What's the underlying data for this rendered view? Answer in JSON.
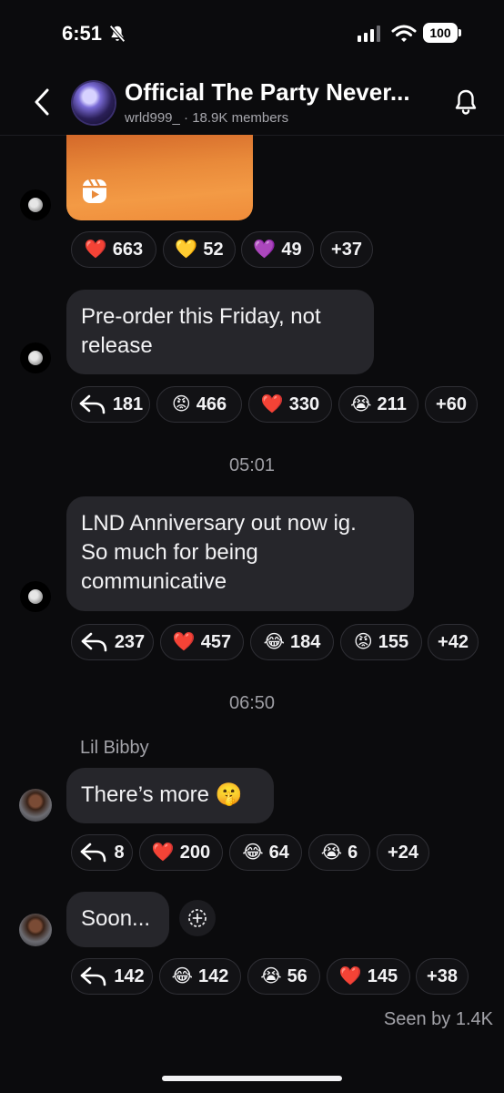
{
  "status_bar": {
    "time": "6:51",
    "battery": "100"
  },
  "header": {
    "title": "Official The Party Never...",
    "subtitle": "wrld999_ · 18.9K members"
  },
  "messages": [
    {
      "type": "reel",
      "reactions": [
        {
          "emoji": "❤️",
          "count": "663"
        },
        {
          "emoji": "💛",
          "count": "52"
        },
        {
          "emoji": "💜",
          "count": "49"
        },
        {
          "emoji": "",
          "count": "+37"
        }
      ]
    },
    {
      "type": "text",
      "text_lines": [
        "Pre-order this Friday, not",
        "release"
      ],
      "reactions": [
        {
          "emoji": "reply",
          "count": "181"
        },
        {
          "emoji": "😡",
          "count": "466"
        },
        {
          "emoji": "❤️",
          "count": "330"
        },
        {
          "emoji": "😭",
          "count": "211"
        },
        {
          "emoji": "",
          "count": "+60"
        }
      ]
    },
    {
      "type": "timestamp",
      "text": "05:01"
    },
    {
      "type": "text",
      "text_lines": [
        "LND Anniversary out now ig.",
        "So much for being",
        "communicative"
      ],
      "reactions": [
        {
          "emoji": "reply",
          "count": "237"
        },
        {
          "emoji": "❤️",
          "count": "457"
        },
        {
          "emoji": "😂",
          "count": "184"
        },
        {
          "emoji": "😡",
          "count": "155"
        },
        {
          "emoji": "",
          "count": "+42"
        }
      ]
    },
    {
      "type": "timestamp",
      "text": "06:50"
    },
    {
      "type": "text",
      "sender": "Lil Bibby",
      "text": "There’s more 🤫",
      "reactions": [
        {
          "emoji": "reply",
          "count": "8"
        },
        {
          "emoji": "❤️",
          "count": "200"
        },
        {
          "emoji": "😂",
          "count": "64"
        },
        {
          "emoji": "😭",
          "count": "6"
        },
        {
          "emoji": "",
          "count": "+24"
        }
      ]
    },
    {
      "type": "text",
      "text": "Soon...",
      "reactions": [
        {
          "emoji": "reply",
          "count": "142"
        },
        {
          "emoji": "😂",
          "count": "142"
        },
        {
          "emoji": "😭",
          "count": "56"
        },
        {
          "emoji": "❤️",
          "count": "145"
        },
        {
          "emoji": "",
          "count": "+38"
        }
      ]
    }
  ],
  "seen": "Seen by 1.4K",
  "icons": {
    "back": "chevron-left-icon",
    "bell": "bell-icon",
    "mute": "bell-slash-icon",
    "reel": "reels-icon",
    "reply": "reply-icon",
    "add_reaction": "add-reaction-icon"
  },
  "colors": {
    "background": "#0b0b0d",
    "bubble": "#26262b",
    "chip_border": "#2f2f35",
    "muted_text": "#a3a3a9"
  }
}
